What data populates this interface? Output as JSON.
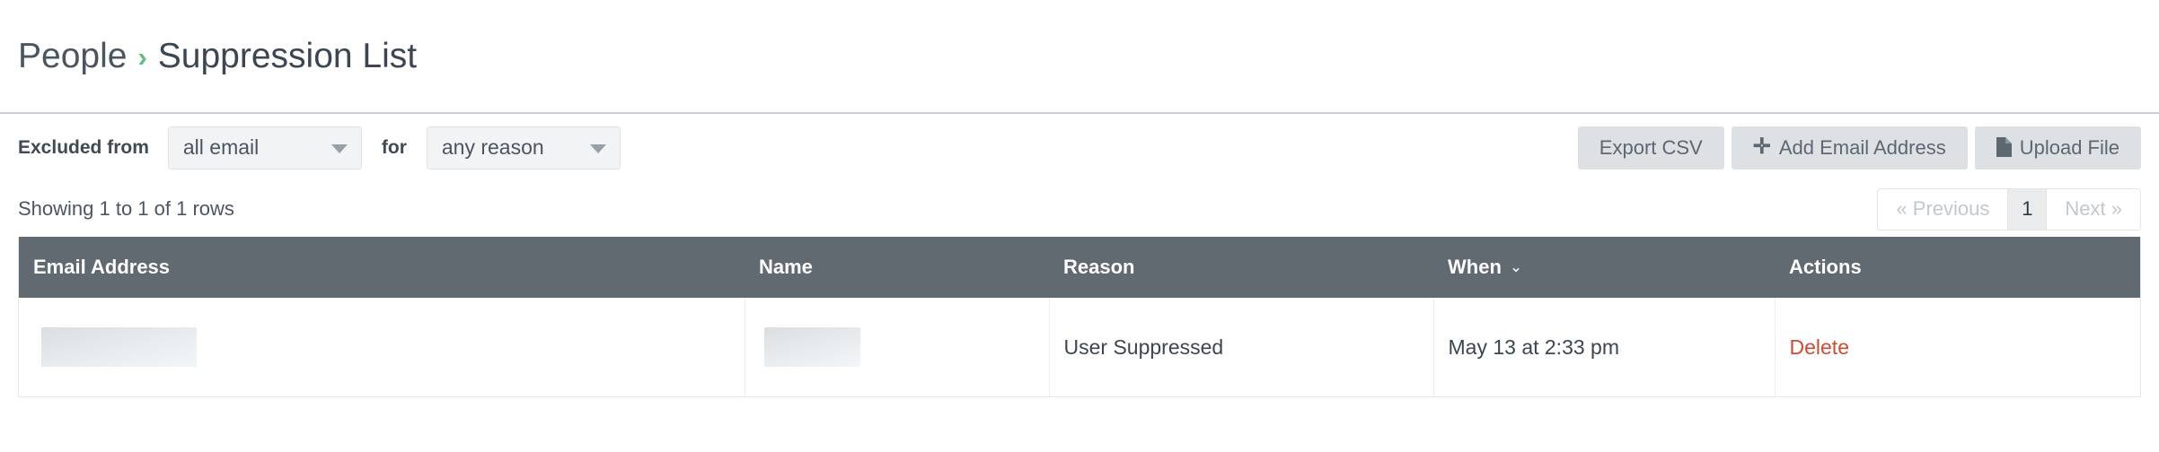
{
  "breadcrumb": {
    "parent": "People",
    "separator": "›",
    "current": "Suppression List"
  },
  "filters": {
    "excluded_label": "Excluded from",
    "audience_select": {
      "value": "all email",
      "caret_icon": "chevron-down-icon"
    },
    "for_label": "for",
    "reason_select": {
      "value": "any reason",
      "caret_icon": "chevron-down-icon"
    }
  },
  "toolbar": {
    "export_label": "Export CSV",
    "add_email_label": "Add Email Address",
    "add_email_icon": "plus-icon",
    "upload_label": "Upload File",
    "upload_icon": "file-icon"
  },
  "meta": {
    "showing_text": "Showing 1 to 1 of 1 rows"
  },
  "pagination": {
    "previous_label": "« Previous",
    "current_page": "1",
    "next_label": "Next »"
  },
  "table": {
    "columns": [
      {
        "label": "Email Address",
        "sort_icon": ""
      },
      {
        "label": "Name",
        "sort_icon": ""
      },
      {
        "label": "Reason",
        "sort_icon": ""
      },
      {
        "label": "When",
        "sort_icon": "⌄"
      },
      {
        "label": "Actions",
        "sort_icon": ""
      }
    ],
    "rows": [
      {
        "email": "",
        "name": "",
        "reason": "User Suppressed",
        "when": "May 13 at 2:33 pm",
        "action_label": "Delete"
      }
    ]
  },
  "colors": {
    "header_bg": "#626a71",
    "accent_green": "#5cbf7f",
    "delete_red": "#cf4a33",
    "button_bg": "#dde1e4"
  }
}
